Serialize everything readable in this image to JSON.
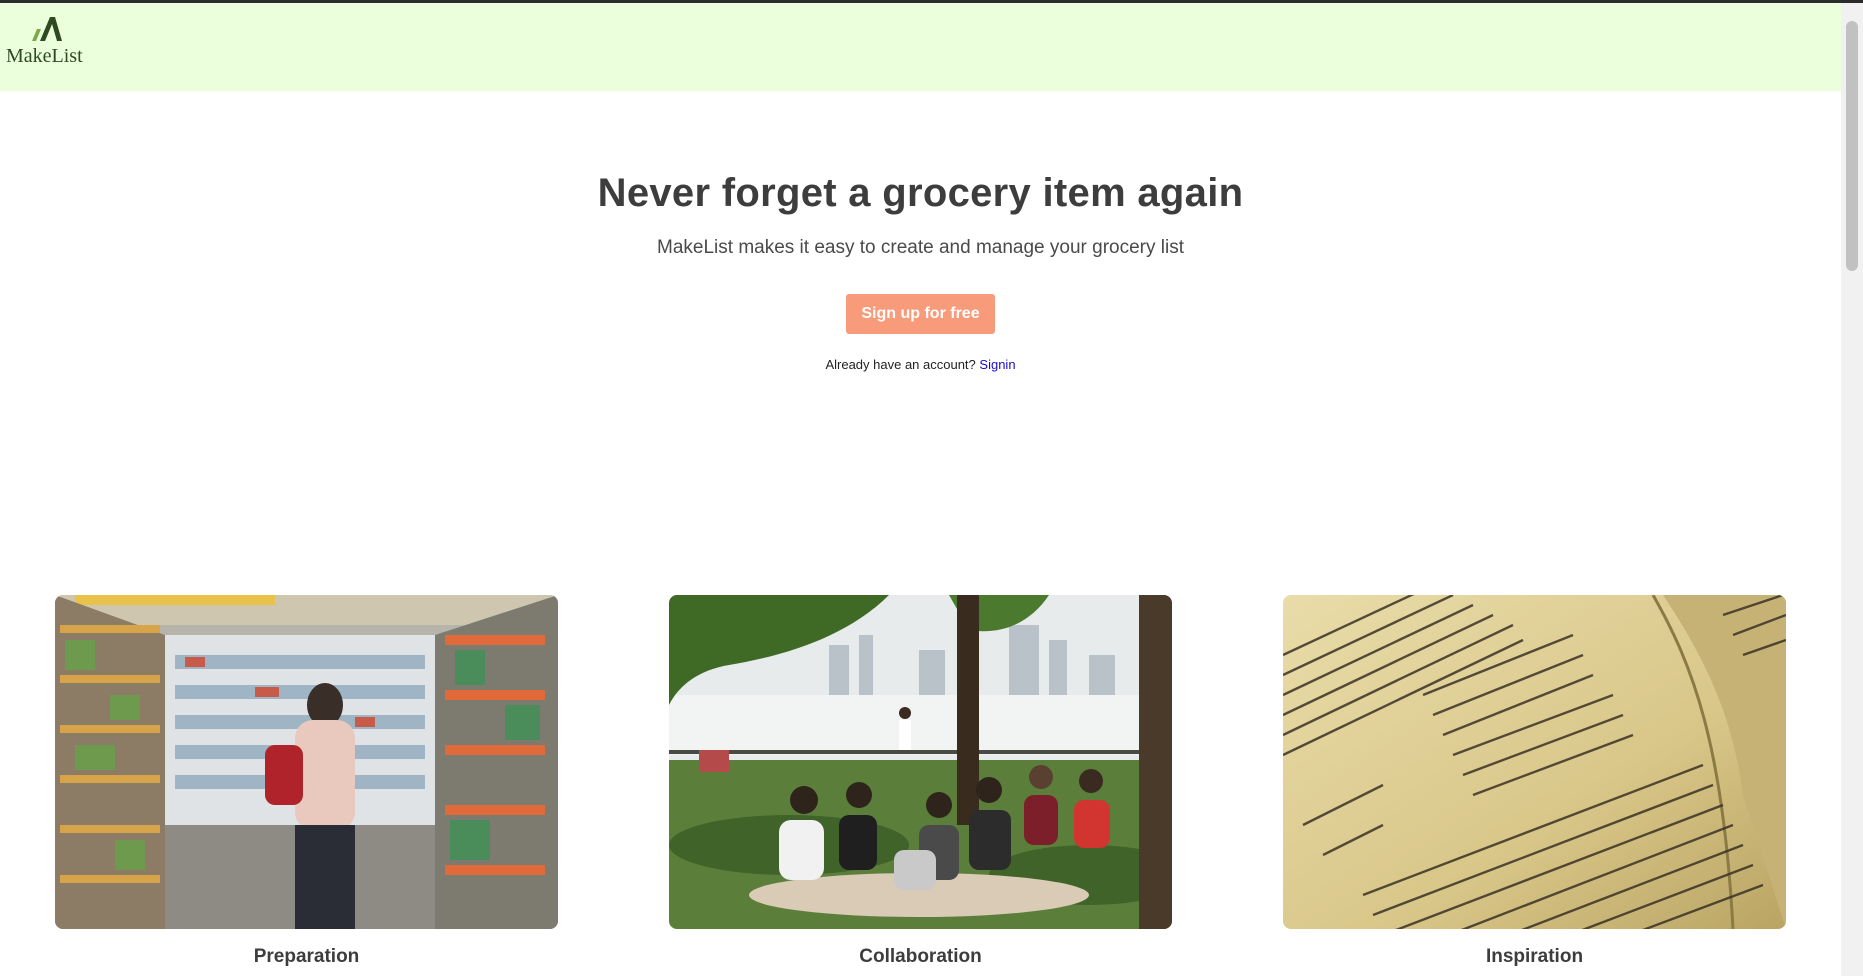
{
  "header": {
    "logo_text": "MakeList",
    "background_color": "#ecffdc"
  },
  "hero": {
    "title": "Never forget a grocery item again",
    "subtitle": "MakeList makes it easy to create and manage your grocery list",
    "signup_label": "Sign up for free",
    "signup_color": "#f89b7b",
    "signin_prompt": "Already have an account?",
    "signin_link": "Signin"
  },
  "features": [
    {
      "title": "Preparation",
      "image": "grocery-store-photo"
    },
    {
      "title": "Collaboration",
      "image": "picnic-group-photo"
    },
    {
      "title": "Inspiration",
      "image": "recipe-book-photo"
    }
  ]
}
